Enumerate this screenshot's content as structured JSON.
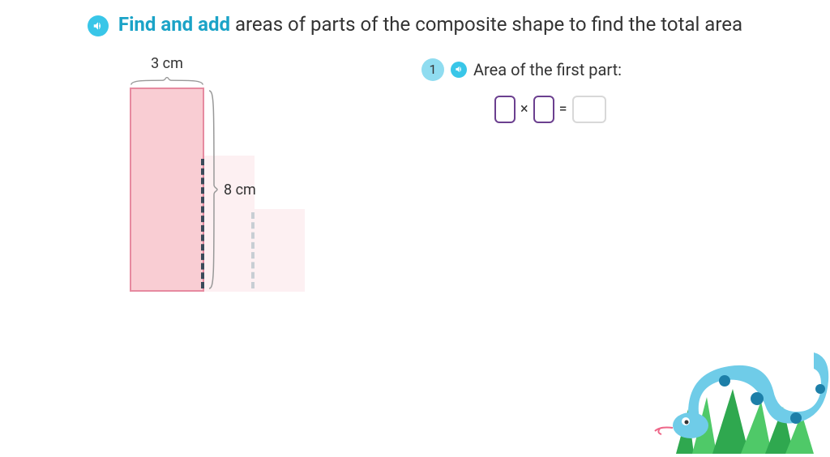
{
  "header": {
    "emphasis": "Find and add",
    "rest": " areas of parts of the composite shape to find the total area"
  },
  "shape": {
    "width_label": "3 cm",
    "height_label": "8 cm"
  },
  "question": {
    "step_number": "1",
    "prompt": "Area of the first part:",
    "operator": "×",
    "equals": "="
  }
}
